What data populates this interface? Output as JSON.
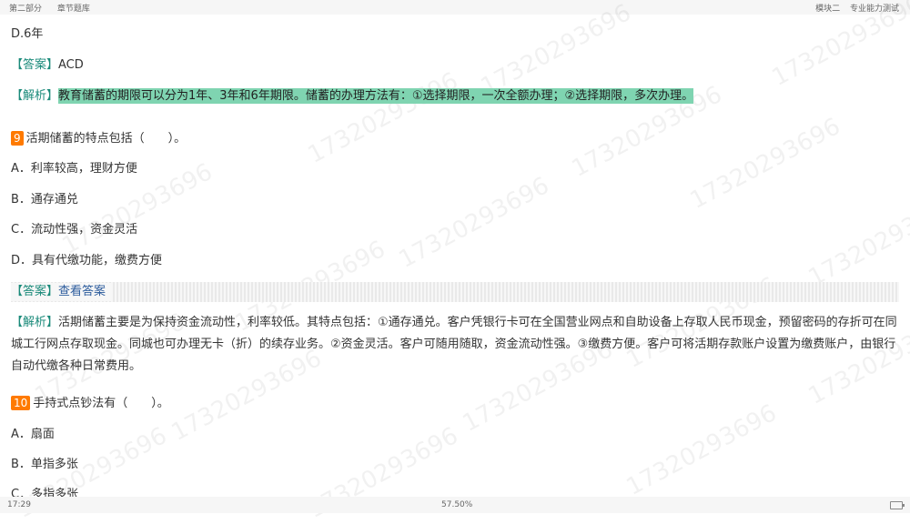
{
  "topbar": {
    "left": [
      "第二部分",
      "章节题库"
    ],
    "right": [
      "模块二",
      "专业能力测试"
    ]
  },
  "lines": {
    "opt_d_prev": "D.6年",
    "ans_prev_tag": "【答案】",
    "ans_prev_val": "ACD",
    "exp_prev_tag": "【解析】",
    "exp_prev_text": "教育储蓄的期限可以分为1年、3年和6年期限。储蓄的办理方法有：①选择期限，一次全额办理；②选择期限，多次办理。"
  },
  "q9": {
    "num": "9",
    "text": "活期储蓄的特点包括（　　）。",
    "options": [
      "A．利率较高，理财方便",
      "B．通存通兑",
      "C．流动性强，资金灵活",
      "D．具有代缴功能，缴费方便"
    ],
    "answer_tag": "【答案】",
    "answer_link": "查看答案",
    "exp_tag": "【解析】",
    "exp_text": "活期储蓄主要是为保持资金流动性，利率较低。其特点包括：①通存通兑。客户凭银行卡可在全国营业网点和自助设备上存取人民币现金，预留密码的存折可在同城工行网点存取现金。同城也可办理无卡（折）的续存业务。②资金灵活。客户可随用随取，资金流动性强。③缴费方便。客户可将活期存款账户设置为缴费账户，由银行自动代缴各种日常费用。"
  },
  "q10": {
    "num": "10",
    "text": "手持式点钞法有（　　）。",
    "options": [
      "A．扇面",
      "B．单指多张",
      "C．多指多张"
    ]
  },
  "bottombar": {
    "time": "17:29",
    "progress": "57.50%"
  },
  "watermark": "17320293696",
  "colors": {
    "tag": "#1a8a7a",
    "highlight": "#7fd4b1",
    "qnum_bg": "#ff7a00",
    "link": "#2b5b9c"
  }
}
